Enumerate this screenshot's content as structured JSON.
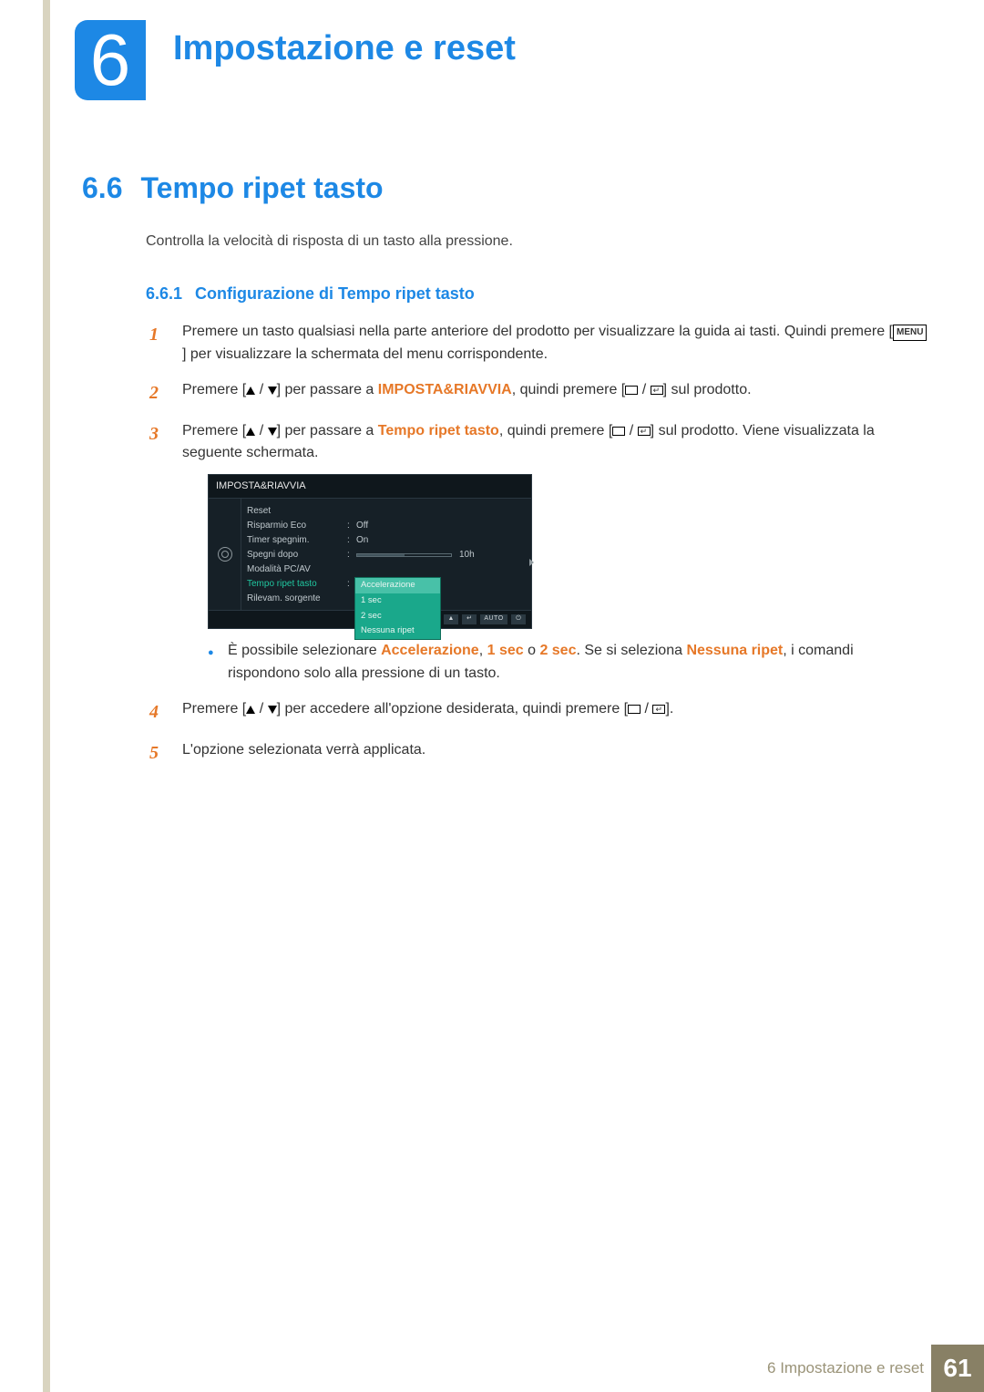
{
  "chapter": {
    "number": "6",
    "title": "Impostazione e reset"
  },
  "section": {
    "number": "6.6",
    "title": "Tempo ripet tasto",
    "description": "Controlla la velocità di risposta di un tasto alla pressione."
  },
  "subsection": {
    "number": "6.6.1",
    "title": "Configurazione di Tempo ripet tasto"
  },
  "steps": {
    "s1_a": "Premere un tasto qualsiasi nella parte anteriore del prodotto per visualizzare la guida ai tasti. Quindi premere [",
    "s1_b": "] per visualizzare la schermata del menu corrispondente.",
    "s2_a": "Premere [",
    "s2_b": "] per passare a ",
    "s2_c": "IMPOSTA&RIAVVIA",
    "s2_d": ", quindi premere [",
    "s2_e": "] sul prodotto.",
    "s3_a": "Premere [",
    "s3_b": "] per passare a ",
    "s3_c": "Tempo ripet tasto",
    "s3_d": ", quindi premere [",
    "s3_e": "] sul prodotto. Viene visualizzata la seguente schermata.",
    "bullet_a": "È possibile selezionare ",
    "bullet_b": "Accelerazione",
    "bullet_c": ", ",
    "bullet_d": "1 sec",
    "bullet_e": " o ",
    "bullet_f": "2 sec",
    "bullet_g": ". Se si seleziona ",
    "bullet_h": "Nessuna ripet",
    "bullet_i": ", i comandi rispondono solo alla pressione di un tasto.",
    "s4_a": "Premere [",
    "s4_b": "] per accedere all'opzione desiderata, quindi premere [",
    "s4_c": "].",
    "s5": "L'opzione selezionata verrà applicata."
  },
  "step_nums": {
    "n1": "1",
    "n2": "2",
    "n3": "3",
    "n4": "4",
    "n5": "5"
  },
  "menu_key": "MENU",
  "osd": {
    "title": "IMPOSTA&RIAVVIA",
    "rows": {
      "reset": "Reset",
      "eco": "Risparmio Eco",
      "eco_v": "Off",
      "timer": "Timer spegnim.",
      "timer_v": "On",
      "spegni": "Spegni dopo",
      "spegni_v": "10h",
      "pcav": "Modalità PC/AV",
      "tempo": "Tempo ripet tasto",
      "rilev": "Rilevam. sorgente"
    },
    "popup": {
      "p1": "Accelerazione",
      "p2": "1 sec",
      "p3": "2 sec",
      "p4": "Nessuna ripet"
    },
    "nav": {
      "b1": "◄",
      "b2": "▼",
      "b3": "▲",
      "b4": "↵",
      "auto": "AUTO",
      "pwr": "⏻"
    }
  },
  "footer": {
    "label": "6 Impostazione e reset",
    "page": "61"
  }
}
